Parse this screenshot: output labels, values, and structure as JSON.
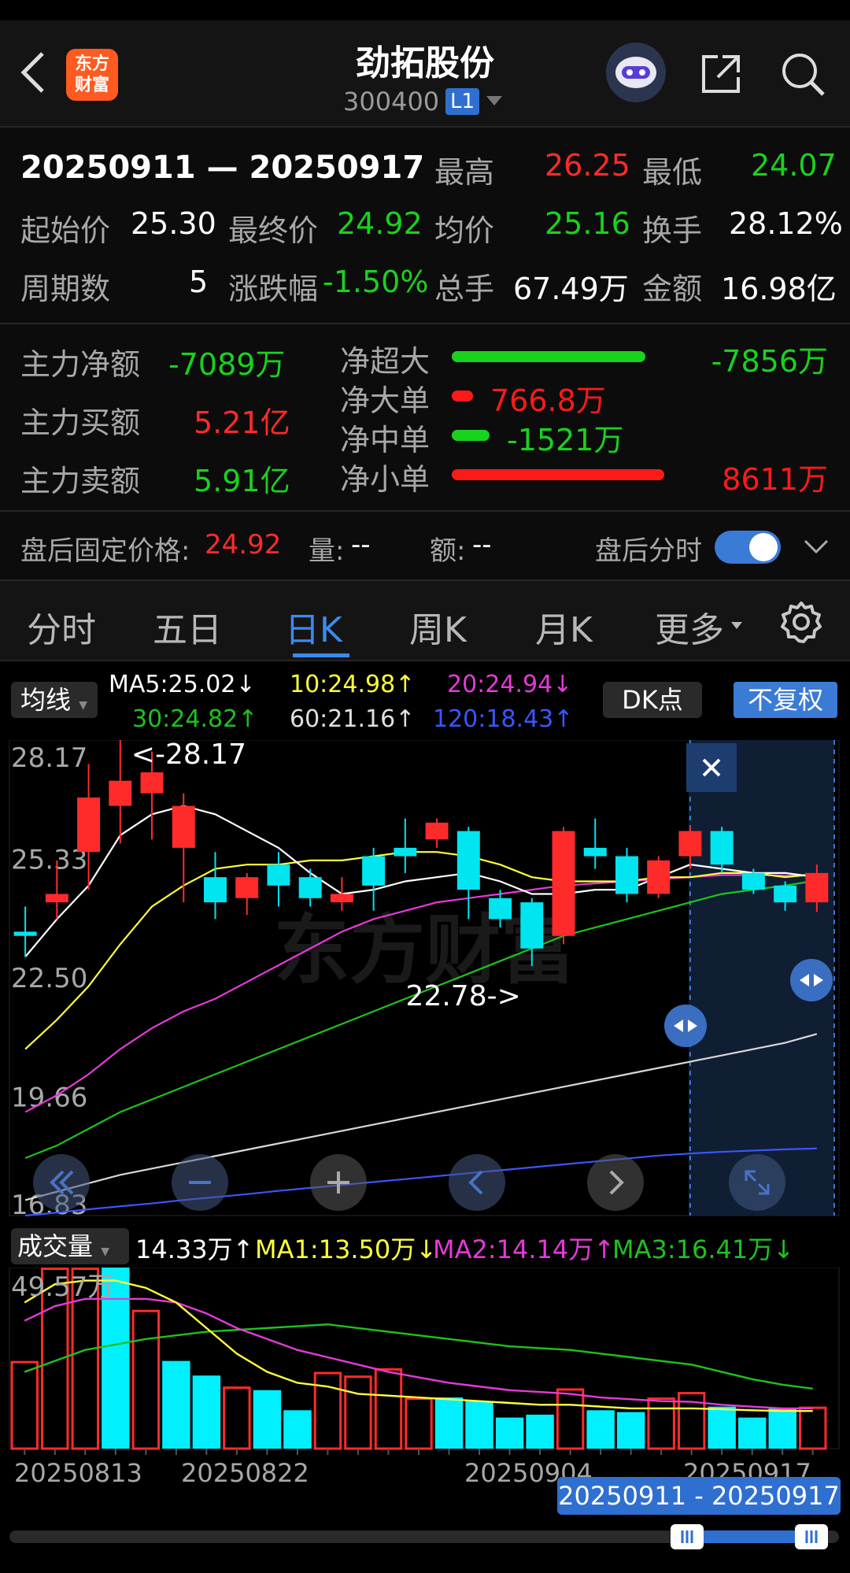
{
  "header": {
    "stock_name": "劲拓股份",
    "stock_code": "300400",
    "level_badge": "L1",
    "logo_line1": "东方",
    "logo_line2": "财富"
  },
  "summary": {
    "date_range": "20250911 — 20250917",
    "high_label": "最高",
    "high_value": "26.25",
    "low_label": "最低",
    "low_value": "24.07",
    "open_label": "起始价",
    "open_value": "25.30",
    "close_label": "最终价",
    "close_value": "24.92",
    "avg_label": "均价",
    "avg_value": "25.16",
    "turnover_label": "换手",
    "turnover_value": "28.12%",
    "periods_label": "周期数",
    "periods_value": "5",
    "change_label": "涨跌幅",
    "change_value": "-1.50%",
    "volume_label": "总手",
    "volume_value": "67.49万",
    "amount_label": "金额",
    "amount_value": "16.98亿"
  },
  "fund_flow": {
    "main_net_label": "主力净额",
    "main_net_value": "-7089万",
    "main_buy_label": "主力买额",
    "main_buy_value": "5.21亿",
    "main_sell_label": "主力卖额",
    "main_sell_value": "5.91亿",
    "bars": [
      {
        "label": "净超大",
        "value": "-7856万",
        "color": "#19d21e",
        "fraction": 0.82
      },
      {
        "label": "净大单",
        "value": "766.8万",
        "color": "#ff1a1a",
        "fraction": 0.09
      },
      {
        "label": "净中单",
        "value": "-1521万",
        "color": "#19d21e",
        "fraction": 0.16
      },
      {
        "label": "净小单",
        "value": "8611万",
        "color": "#ff1a1a",
        "fraction": 0.9
      }
    ]
  },
  "after_hours": {
    "price_label": "盘后固定价格:",
    "price_value": "24.92",
    "vol_label": "量:",
    "vol_value": "--",
    "amt_label": "额:",
    "amt_value": "--",
    "toggle_label": "盘后分时"
  },
  "tabs": [
    "分时",
    "五日",
    "日K",
    "周K",
    "月K",
    "更多"
  ],
  "active_tab": "日K",
  "ma_legend": {
    "selector": "均线",
    "ma5": "MA5:25.02↓",
    "ma10": "10:24.98↑",
    "ma20": "20:24.94↓",
    "ma30": "30:24.82↑",
    "ma60": "60:21.16↑",
    "ma120": "120:18.43↑",
    "dk_button": "DK点",
    "adjust_button": "不复权"
  },
  "volume_legend": {
    "selector": "成交量",
    "vol": "14.33万↑",
    "ma1": "MA1:13.50万↓",
    "ma2": "MA2:14.14万↑",
    "ma3": "MA3:16.41万↓"
  },
  "colors": {
    "up": "#ff2b2b",
    "down": "#00e5f0",
    "accent": "#3a7bd5"
  },
  "chart_data": {
    "type": "candlestick",
    "ylim": [
      16.83,
      28.17
    ],
    "y_ticks": [
      "28.17",
      "25.33",
      "22.50",
      "19.66",
      "16.83"
    ],
    "annotations": [
      "<-28.17",
      "22.78->"
    ],
    "watermark": "东方财富",
    "x_labels": [
      "20250813",
      "20250822",
      "20250904",
      "20250917"
    ],
    "selection_label": "20250911 - 20250917",
    "candles": [
      {
        "o": 23.6,
        "c": 23.5,
        "h": 24.2,
        "l": 23.0
      },
      {
        "o": 24.3,
        "c": 24.5,
        "h": 25.3,
        "l": 23.9
      },
      {
        "o": 25.5,
        "c": 26.8,
        "h": 27.6,
        "l": 24.6
      },
      {
        "o": 26.6,
        "c": 27.2,
        "h": 28.17,
        "l": 25.7
      },
      {
        "o": 26.9,
        "c": 27.4,
        "h": 27.9,
        "l": 25.8
      },
      {
        "o": 25.6,
        "c": 26.6,
        "h": 26.9,
        "l": 24.3
      },
      {
        "o": 24.9,
        "c": 24.3,
        "h": 25.5,
        "l": 23.9
      },
      {
        "o": 24.4,
        "c": 24.9,
        "h": 25.0,
        "l": 24.0
      },
      {
        "o": 25.2,
        "c": 24.7,
        "h": 25.5,
        "l": 24.2
      },
      {
        "o": 24.9,
        "c": 24.4,
        "h": 25.1,
        "l": 24.2
      },
      {
        "o": 24.3,
        "c": 24.5,
        "h": 24.9,
        "l": 24.1
      },
      {
        "o": 25.4,
        "c": 24.7,
        "h": 25.6,
        "l": 24.1
      },
      {
        "o": 25.6,
        "c": 25.4,
        "h": 26.3,
        "l": 25.0
      },
      {
        "o": 25.8,
        "c": 26.2,
        "h": 26.3,
        "l": 25.6
      },
      {
        "o": 26.0,
        "c": 24.6,
        "h": 26.1,
        "l": 23.9
      },
      {
        "o": 24.4,
        "c": 23.9,
        "h": 24.6,
        "l": 23.7
      },
      {
        "o": 24.3,
        "c": 23.2,
        "h": 24.4,
        "l": 22.78
      },
      {
        "o": 23.5,
        "c": 26.0,
        "h": 26.1,
        "l": 23.3
      },
      {
        "o": 25.6,
        "c": 25.4,
        "h": 26.3,
        "l": 25.1
      },
      {
        "o": 25.4,
        "c": 24.5,
        "h": 25.6,
        "l": 24.3
      },
      {
        "o": 24.5,
        "c": 25.3,
        "h": 25.4,
        "l": 24.4
      },
      {
        "o": 25.4,
        "c": 26.0,
        "h": 26.1,
        "l": 25.1
      },
      {
        "o": 26.0,
        "c": 25.2,
        "h": 26.1,
        "l": 25.0
      },
      {
        "o": 25.0,
        "c": 24.6,
        "h": 25.1,
        "l": 24.5
      },
      {
        "o": 24.7,
        "c": 24.3,
        "h": 24.8,
        "l": 24.1
      },
      {
        "o": 24.3,
        "c": 25.0,
        "h": 25.2,
        "l": 24.07
      }
    ],
    "ma5": [
      23.0,
      23.9,
      24.7,
      25.9,
      26.4,
      26.6,
      26.4,
      26.0,
      25.6,
      25.0,
      24.5,
      24.6,
      24.8,
      24.9,
      25.0,
      24.8,
      24.5,
      24.5,
      24.6,
      24.6,
      24.9,
      25.2,
      25.1,
      25.0,
      25.0,
      24.9
    ],
    "ma10": [
      20.8,
      21.5,
      22.3,
      23.3,
      24.2,
      24.7,
      25.1,
      25.2,
      25.2,
      25.3,
      25.3,
      25.4,
      25.5,
      25.5,
      25.4,
      25.2,
      24.9,
      24.8,
      24.8,
      24.8,
      24.9,
      24.9,
      25.0,
      25.0,
      24.9,
      24.98
    ],
    "ma20": [
      19.3,
      19.7,
      20.2,
      20.8,
      21.3,
      21.7,
      22.0,
      22.4,
      22.8,
      23.2,
      23.6,
      23.9,
      24.1,
      24.3,
      24.4,
      24.5,
      24.6,
      24.7,
      24.75,
      24.8,
      24.85,
      24.9,
      24.95,
      24.95,
      24.94,
      24.94
    ],
    "ma30": [
      18.2,
      18.5,
      18.9,
      19.3,
      19.6,
      19.9,
      20.2,
      20.5,
      20.8,
      21.1,
      21.4,
      21.7,
      22.0,
      22.3,
      22.6,
      22.9,
      23.2,
      23.5,
      23.7,
      23.9,
      24.1,
      24.3,
      24.5,
      24.6,
      24.7,
      24.82
    ],
    "ma60": [
      17.2,
      17.4,
      17.6,
      17.8,
      17.95,
      18.1,
      18.25,
      18.4,
      18.55,
      18.7,
      18.85,
      19.0,
      19.15,
      19.3,
      19.45,
      19.6,
      19.75,
      19.9,
      20.05,
      20.2,
      20.35,
      20.5,
      20.65,
      20.8,
      20.95,
      21.16
    ],
    "ma120": [
      16.83,
      16.9,
      16.98,
      17.05,
      17.12,
      17.2,
      17.27,
      17.34,
      17.42,
      17.49,
      17.56,
      17.63,
      17.7,
      17.77,
      17.84,
      17.91,
      17.98,
      18.05,
      18.12,
      18.19,
      18.26,
      18.31,
      18.35,
      18.38,
      18.41,
      18.43
    ],
    "volume": {
      "ylim": [
        0,
        49.57
      ],
      "top_label": "49.57万",
      "bars": [
        24,
        49.57,
        49.57,
        49.57,
        38,
        24,
        20,
        17,
        16,
        10.5,
        21,
        20,
        22,
        14,
        14,
        13,
        8.5,
        9.3,
        16.5,
        10.5,
        10,
        14,
        15.5,
        11.5,
        8.5,
        11,
        11.5
      ],
      "colors_up": [
        true,
        true,
        true,
        false,
        true,
        false,
        false,
        true,
        false,
        false,
        true,
        true,
        true,
        true,
        false,
        false,
        false,
        false,
        true,
        false,
        false,
        true,
        true,
        false,
        false,
        false,
        true
      ],
      "ma1": [
        40,
        45,
        46,
        46,
        44,
        40,
        33,
        26,
        21,
        18,
        17,
        15,
        14.5,
        14,
        13.5,
        13,
        12.5,
        12,
        12,
        11.5,
        11,
        11,
        11,
        10.8,
        10.5,
        10.3,
        10.3
      ],
      "ma2": [
        35,
        39,
        41,
        41,
        41,
        40,
        37,
        33,
        30,
        27,
        25,
        23,
        21,
        19.5,
        18,
        17,
        16,
        15.5,
        15,
        14,
        13.5,
        13,
        12.8,
        12,
        11.5,
        11,
        11
      ],
      "ma3": [
        21,
        24,
        27,
        28.5,
        30,
        31,
        32,
        32.5,
        33,
        33.5,
        34,
        33,
        32,
        31,
        30,
        29,
        28,
        27.5,
        27,
        26,
        25,
        24,
        23,
        21,
        19,
        17.5,
        16.41
      ]
    }
  }
}
